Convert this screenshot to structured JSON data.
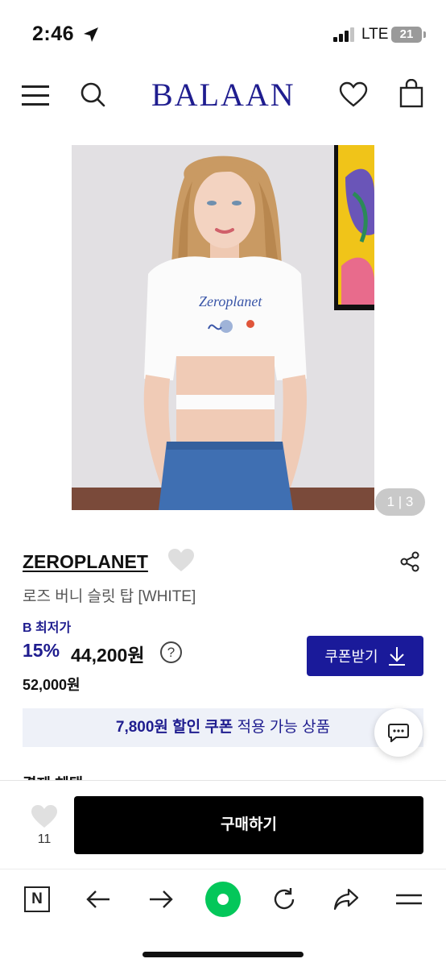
{
  "status_bar": {
    "time": "2:46",
    "network": "LTE",
    "battery": "21"
  },
  "header": {
    "logo": "BALAAN"
  },
  "product": {
    "image_counter": "1 | 3",
    "brand": "ZEROPLANET",
    "name": "로즈 버니 슬릿 탑 [WHITE]",
    "lowest_price_label": "B 최저가",
    "discount_rate": "15%",
    "sale_price": "44,200원",
    "help_glyph": "?",
    "original_price": "52,000원",
    "coupon_button": "쿠폰받기"
  },
  "coupon_banner": {
    "amount": "7,800원 할인 쿠폰",
    "rest": " 적용 가능 상품"
  },
  "section_peek": "결제 혜택",
  "buy_bar": {
    "like_count": "11",
    "buy_label": "구매하기"
  },
  "browser_nav": {
    "n_label": "N"
  },
  "colors": {
    "brand_navy": "#1f1d8f",
    "coupon_button_bg": "#1a1a9a",
    "banner_bg": "#eef1f8",
    "buy_button_bg": "#000000",
    "naver_green": "#03c75a"
  },
  "icons": [
    "location-arrow-icon",
    "signal-icon",
    "battery-icon",
    "menu-icon",
    "search-icon",
    "heart-icon",
    "bag-icon",
    "share-icon",
    "help-icon",
    "download-icon",
    "chat-icon",
    "back-arrow-icon",
    "forward-arrow-icon",
    "refresh-icon",
    "share-forward-icon",
    "menu-lines-icon"
  ]
}
